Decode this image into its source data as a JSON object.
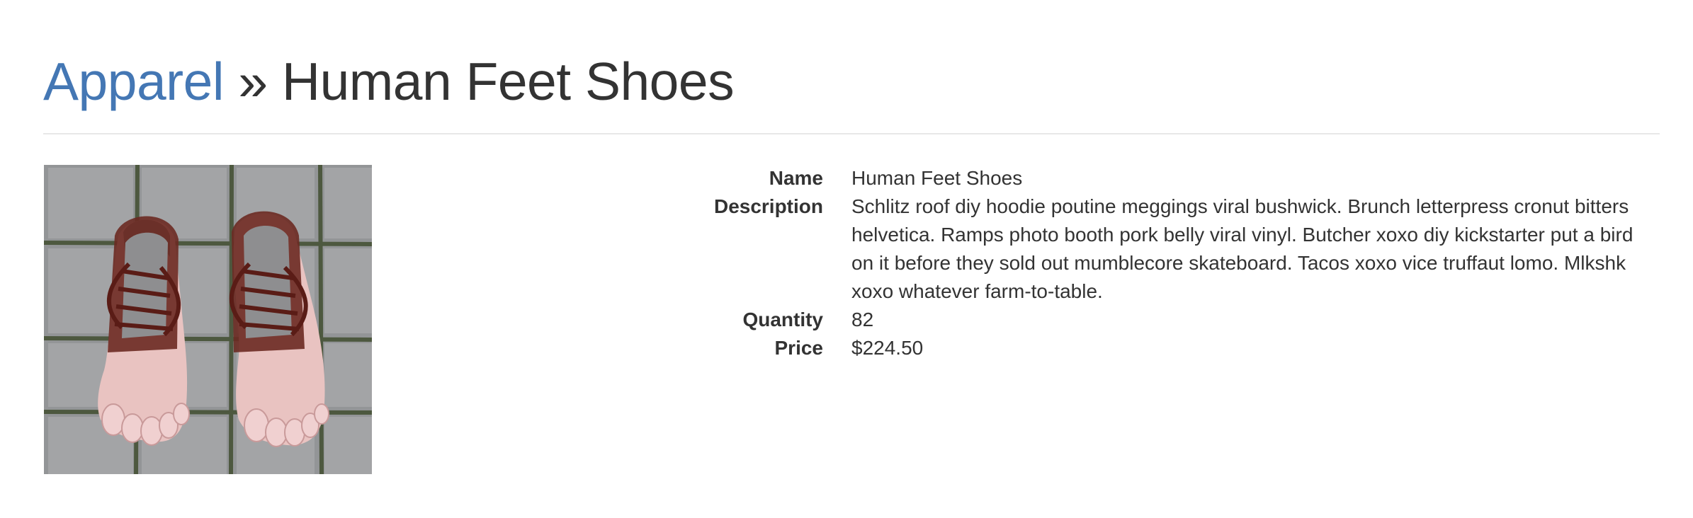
{
  "breadcrumb": {
    "category": "Apparel",
    "separator": "»",
    "current": "Human Feet Shoes"
  },
  "product": {
    "image_alt": "Human Feet Shoes",
    "fields": [
      {
        "label": "Name",
        "value": "Human Feet Shoes"
      },
      {
        "label": "Description",
        "value": "Schlitz roof diy hoodie poutine meggings viral bushwick. Brunch letterpress cronut bitters helvetica. Ramps photo booth pork belly viral vinyl. Butcher xoxo diy kickstarter put a bird on it before they sold out mumblecore skateboard. Tacos xoxo vice truffaut lomo. Mlkshk xoxo whatever farm-to-table."
      },
      {
        "label": "Quantity",
        "value": "82"
      },
      {
        "label": "Price",
        "value": "$224.50"
      }
    ]
  },
  "colors": {
    "link": "#4477b4",
    "text": "#333333",
    "divider": "#e8e8e8"
  }
}
